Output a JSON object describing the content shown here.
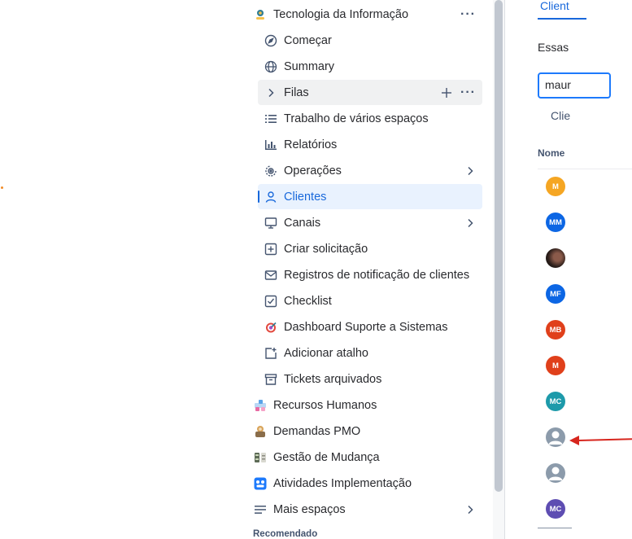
{
  "sidebar": {
    "space_title": "Tecnologia da Informação",
    "items": [
      {
        "label": "Começar",
        "icon": "compass-icon"
      },
      {
        "label": "Summary",
        "icon": "globe-icon"
      },
      {
        "label": "Filas",
        "icon": "chevron-right-icon"
      },
      {
        "label": "Trabalho de vários espaços",
        "icon": "list-icon"
      },
      {
        "label": "Relatórios",
        "icon": "bar-chart-icon"
      },
      {
        "label": "Operações",
        "icon": "operations-icon"
      },
      {
        "label": "Clientes",
        "icon": "person-icon"
      },
      {
        "label": "Canais",
        "icon": "monitor-icon"
      },
      {
        "label": "Criar solicitação",
        "icon": "plus-square-icon"
      },
      {
        "label": "Registros de notificação de clientes",
        "icon": "mail-icon"
      },
      {
        "label": "Checklist",
        "icon": "checkbox-icon"
      },
      {
        "label": "Dashboard Suporte a Sistemas",
        "icon": "target-icon"
      },
      {
        "label": "Adicionar atalho",
        "icon": "add-shortcut-icon"
      },
      {
        "label": "Tickets arquivados",
        "icon": "archive-icon"
      }
    ],
    "spaces": [
      {
        "label": "Recursos Humanos",
        "icon": "hr-space-icon"
      },
      {
        "label": "Demandas PMO",
        "icon": "pmo-space-icon"
      },
      {
        "label": "Gestão de Mudança",
        "icon": "change-space-icon"
      },
      {
        "label": "Atividades Implementação",
        "icon": "implementation-space-icon"
      },
      {
        "label": "Mais espaços",
        "icon": "more-spaces-icon"
      }
    ],
    "section_label": "Recomendado",
    "selected_color": "#1868db"
  },
  "main": {
    "tab_label": "Client",
    "description": "Essas",
    "search_value": "maur",
    "filter_label": "Clie",
    "column_header": "Nome",
    "avatars": [
      {
        "initials": "M",
        "color": "#f5a623"
      },
      {
        "initials": "MM",
        "color": "#0c66e4"
      },
      {
        "initials": "",
        "color": "#2b1e1a"
      },
      {
        "initials": "MF",
        "color": "#0c66e4"
      },
      {
        "initials": "MB",
        "color": "#e0401b"
      },
      {
        "initials": "M",
        "color": "#e0401b"
      },
      {
        "initials": "MC",
        "color": "#1d9aaa"
      },
      {
        "initials": "",
        "color": "#8c9bab"
      },
      {
        "initials": "",
        "color": "#8c9bab"
      },
      {
        "initials": "MC",
        "color": "#5e4db2"
      }
    ],
    "annotation_color": "#d7261e"
  }
}
